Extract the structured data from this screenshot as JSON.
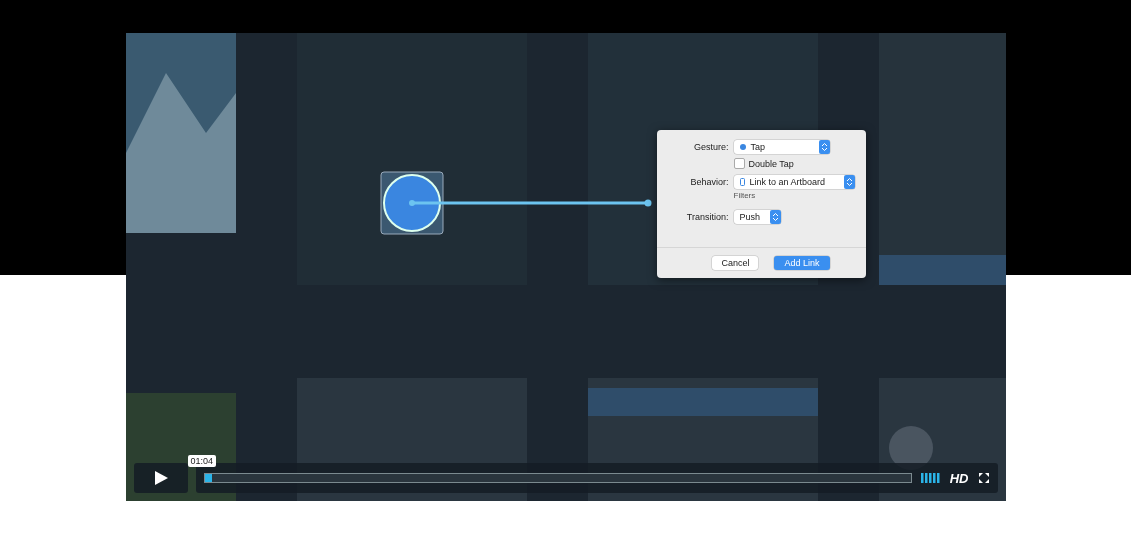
{
  "video": {
    "dialog": {
      "gesture": {
        "label": "Gesture:",
        "value": "Tap"
      },
      "double_tap": {
        "label": "Double Tap",
        "checked": false
      },
      "behavior": {
        "label": "Behavior:",
        "value": "Link to an Artboard"
      },
      "filters": "Filters",
      "transition": {
        "label": "Transition:",
        "value": "Push"
      },
      "buttons": [
        {
          "label": "Cancel",
          "kind": "default"
        },
        {
          "label": "Add Link",
          "kind": "primary"
        }
      ]
    },
    "controls": {
      "time": "01:04",
      "progress": {
        "level": 0.01
      },
      "quality": "HD"
    }
  }
}
